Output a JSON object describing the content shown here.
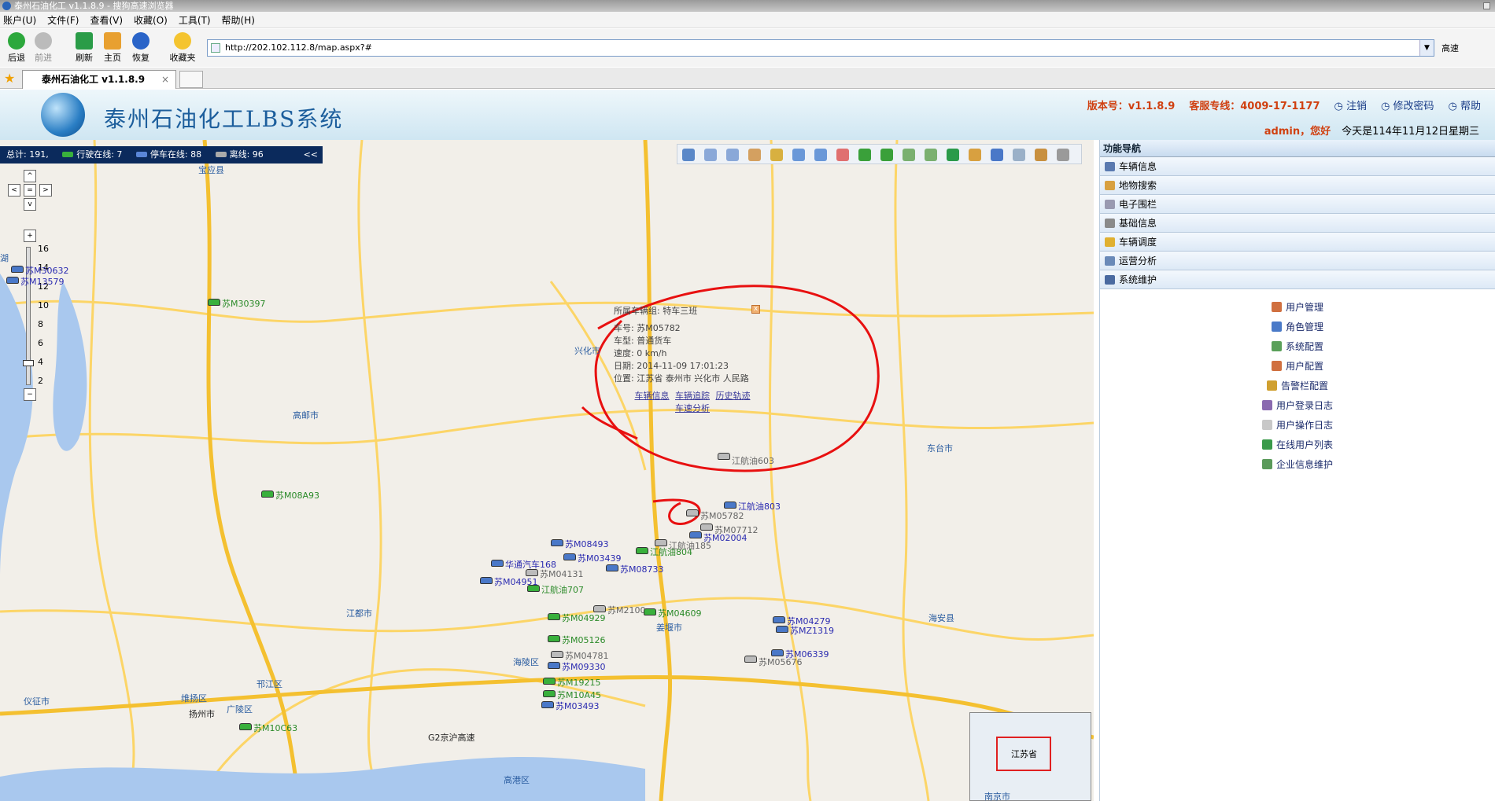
{
  "window": {
    "title": "泰州石油化工 v1.1.8.9 - 搜狗高速浏览器"
  },
  "menu": [
    "账户(U)",
    "文件(F)",
    "查看(V)",
    "收藏(O)",
    "工具(T)",
    "帮助(H)"
  ],
  "nav": {
    "back": "后退",
    "forward": "前进",
    "refresh": "刷新",
    "home": "主页",
    "restore": "恢复",
    "favorites": "收藏夹"
  },
  "address": {
    "url": "http://202.102.112.8/map.aspx?#",
    "speed_label": "高速"
  },
  "tab": {
    "label": "泰州石油化工 v1.1.8.9",
    "close": "×"
  },
  "header": {
    "system_title": "泰州石油化工LBS系统",
    "version": "版本号：v1.1.8.9",
    "hotline": "客服专线：4009-17-1177",
    "logout": "注销",
    "change_pwd": "修改密码",
    "help": "帮助",
    "user": "admin，您好",
    "today": "今天是114年11月12日星期三"
  },
  "stats": {
    "total": "总计: 191,",
    "moving": "行驶在线: 7",
    "parked": "停车在线: 88",
    "offline": "离线: 96",
    "collapse": "<<"
  },
  "zoom_levels": [
    "16",
    "14",
    "12",
    "10",
    "8",
    "6",
    "4",
    "2"
  ],
  "popup": {
    "group": "所属车辆组: 特车三班",
    "plate": "车号: 苏M05782",
    "type": "车型: 普通货车",
    "speed": "速度: 0 km/h",
    "date": "日期: 2014-11-09 17:01:23",
    "position": "位置: 江苏省 泰州市 兴化市 人民路",
    "links": [
      "车辆信息",
      "车辆追踪",
      "历史轨迹",
      "车速分析"
    ]
  },
  "cities": [
    "宝应县",
    "兴化市",
    "高邮市",
    "东台市",
    "江都市",
    "姜堰市",
    "海安县",
    "海陵区",
    "邗江区",
    "维扬区",
    "扬州市",
    "广陵区",
    "仪征市",
    "高港区",
    "G2京沪高速",
    "湖"
  ],
  "vehicles": [
    "苏M30632",
    "苏M13579",
    "苏M30397",
    "苏M08A93",
    "江航油603",
    "江航油803",
    "苏M05782",
    "苏M07712",
    "苏M08493",
    "苏M03439",
    "苏M08733",
    "江航油804",
    "华通汽车168",
    "苏M04131",
    "江航油707",
    "苏M04951",
    "苏M04929",
    "苏M2100",
    "苏M04609",
    "苏M05126",
    "苏M04279",
    "苏MZ1319",
    "苏M06339",
    "苏M05676",
    "苏M04781",
    "苏M09330",
    "苏M19215",
    "苏M10A45",
    "苏M03493",
    "苏M10C63",
    "江航油185",
    "苏M02004"
  ],
  "overview": {
    "province": "江苏省",
    "city": "南京市"
  },
  "sidebar": {
    "title": "功能导航",
    "menu": [
      "车辆信息",
      "地物搜索",
      "电子围栏",
      "基础信息",
      "车辆调度",
      "运营分析",
      "系统维护"
    ],
    "sub": [
      "用户管理",
      "角色管理",
      "系统配置",
      "用户配置",
      "告警栏配置",
      "用户登录日志",
      "用户操作日志",
      "在线用户列表",
      "企业信息维护"
    ]
  }
}
